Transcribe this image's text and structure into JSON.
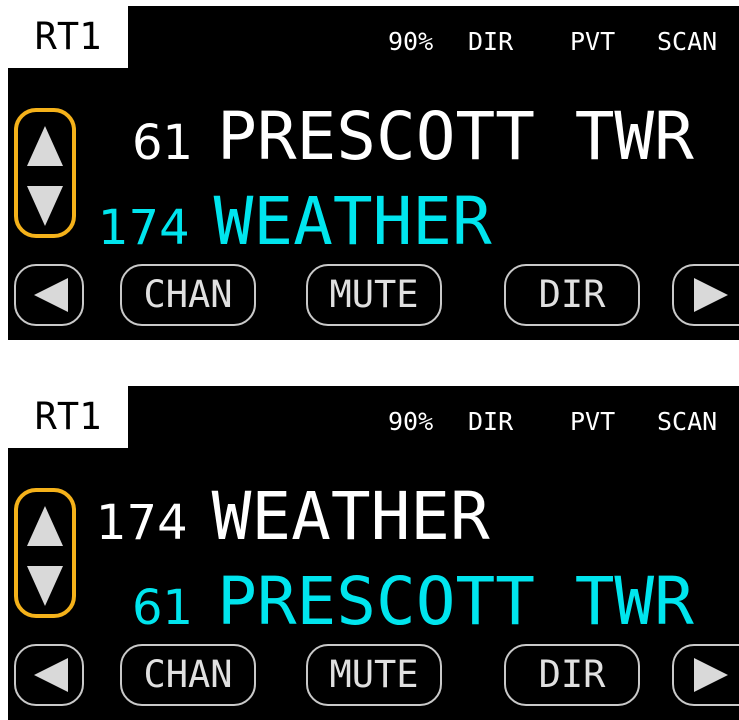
{
  "colors": {
    "background": "#000000",
    "selected_text": "#ffffff",
    "secondary_text": "#00e5ee",
    "scroll_border": "#f5b21a",
    "button_border": "#c9c9c9"
  },
  "panels": [
    {
      "radio_label": "RT1",
      "status": {
        "volume": "90%",
        "mode": "DIR",
        "privacy": "PVT",
        "scan": "SCAN"
      },
      "primary": {
        "number": "61",
        "name": "PRESCOTT TWR"
      },
      "secondary": {
        "number": "174",
        "name": "WEATHER"
      },
      "buttons": {
        "chan": "CHAN",
        "mute": "MUTE",
        "dir": "DIR"
      }
    },
    {
      "radio_label": "RT1",
      "status": {
        "volume": "90%",
        "mode": "DIR",
        "privacy": "PVT",
        "scan": "SCAN"
      },
      "primary": {
        "number": "174",
        "name": "WEATHER"
      },
      "secondary": {
        "number": "61",
        "name": "PRESCOTT TWR"
      },
      "buttons": {
        "chan": "CHAN",
        "mute": "MUTE",
        "dir": "DIR"
      }
    }
  ],
  "icons": {
    "scroll_up": "up-triangle-icon",
    "scroll_down": "down-triangle-icon",
    "prev": "left-triangle-icon",
    "next": "right-triangle-icon"
  }
}
